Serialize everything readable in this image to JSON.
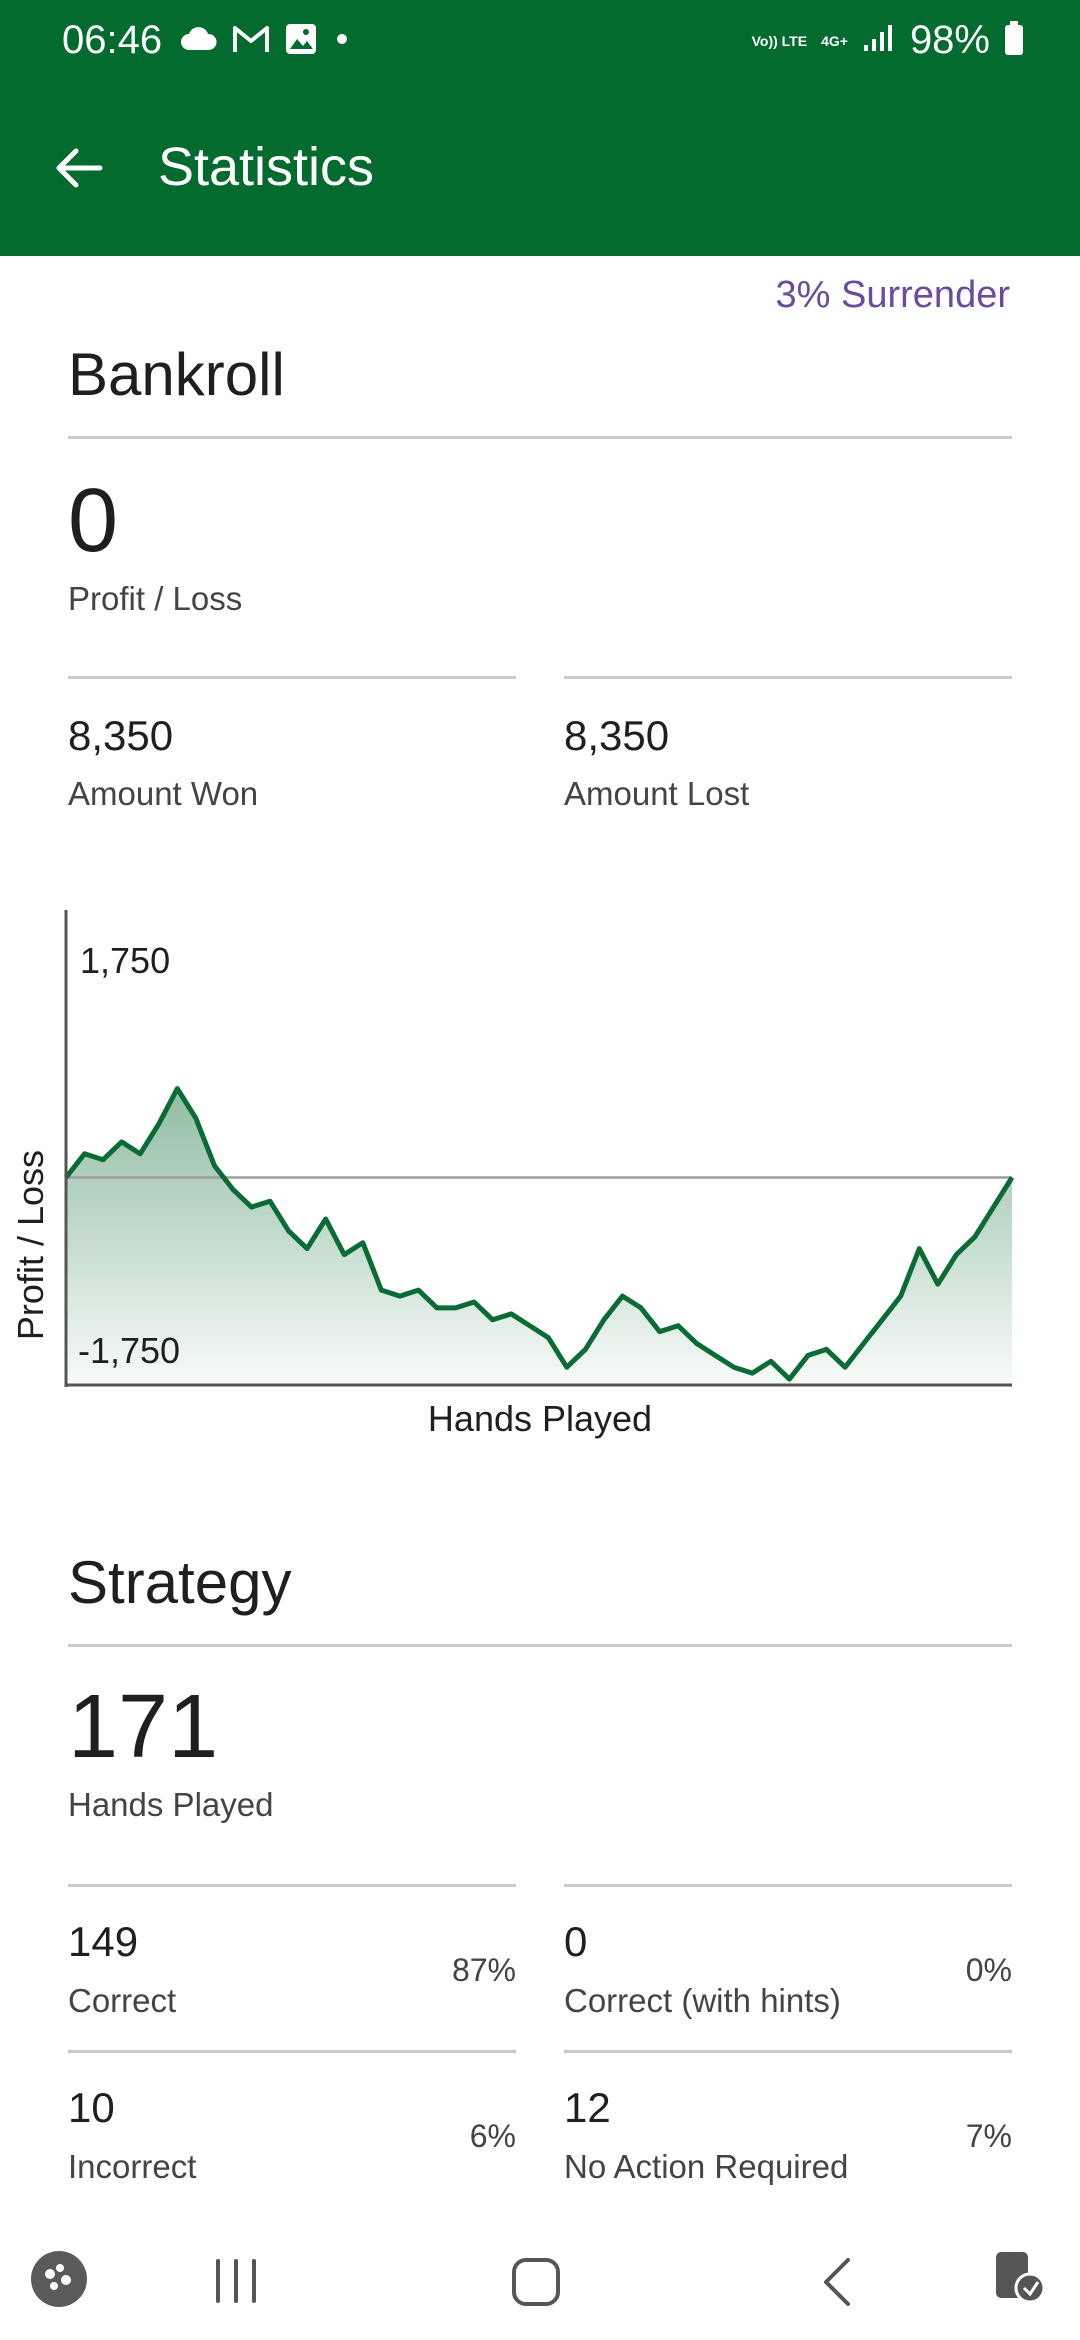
{
  "status": {
    "time": "06:46",
    "battery": "98%",
    "net_top": "Vo)) LTE",
    "net_gen": "4G+"
  },
  "app_bar": {
    "title": "Statistics"
  },
  "mode_label": "3% Surrender",
  "bankroll": {
    "title": "Bankroll",
    "profit_value": "0",
    "profit_label": "Profit / Loss",
    "won_value": "8,350",
    "won_label": "Amount Won",
    "lost_value": "8,350",
    "lost_label": "Amount Lost"
  },
  "chart_data": {
    "type": "area",
    "xlabel": "Hands Played",
    "ylabel": "Profit / Loss",
    "ylim": [
      -1750,
      1750
    ],
    "y_tick_labels": [
      "1,750",
      "-1,750"
    ],
    "grid": false,
    "series": [
      {
        "values": [
          0,
          200,
          150,
          300,
          200,
          450,
          750,
          500,
          100,
          -100,
          -250,
          -200,
          -450,
          -600,
          -350,
          -650,
          -550,
          -950,
          -1000,
          -950,
          -1100,
          -1100,
          -1050,
          -1200,
          -1150,
          -1250,
          -1350,
          -1600,
          -1450,
          -1200,
          -1000,
          -1100,
          -1300,
          -1250,
          -1400,
          -1500,
          -1600,
          -1650,
          -1550,
          -1700,
          -1500,
          -1450,
          -1600,
          -1400,
          -1200,
          -1000,
          -600,
          -900,
          -650,
          -500,
          -250,
          0
        ]
      }
    ],
    "color": "#0b6b34"
  },
  "strategy": {
    "title": "Strategy",
    "hands_value": "171",
    "hands_label": "Hands Played",
    "correct_value": "149",
    "correct_label": "Correct",
    "correct_pct": "87%",
    "hints_value": "0",
    "hints_label": "Correct (with hints)",
    "hints_pct": "0%",
    "incorrect_value": "10",
    "incorrect_label": "Incorrect",
    "incorrect_pct": "6%",
    "noaction_value": "12",
    "noaction_label": "No Action Required",
    "noaction_pct": "7%"
  },
  "colors": {
    "brand": "#046b2e",
    "accent": "#6a4c9c"
  }
}
